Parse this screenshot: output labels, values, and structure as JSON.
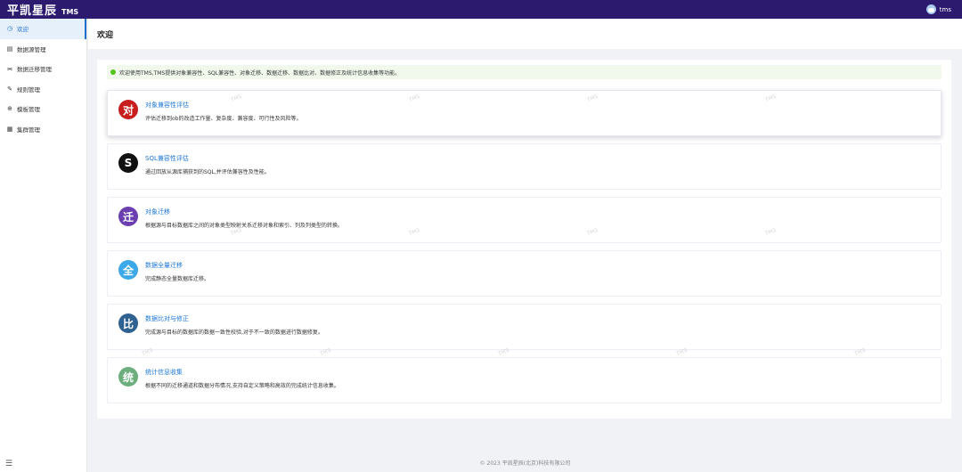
{
  "header": {
    "brand_cn": "平凯星辰",
    "brand_en": "TMS",
    "username": "tms"
  },
  "sidebar": {
    "items": [
      {
        "label": "欢迎",
        "icon": "clock-icon",
        "glyph": "◷"
      },
      {
        "label": "数据源管理",
        "icon": "document-icon",
        "glyph": "▤"
      },
      {
        "label": "数据迁移管理",
        "icon": "share-icon",
        "glyph": "⫘"
      },
      {
        "label": "规则管理",
        "icon": "edit-icon",
        "glyph": "✎"
      },
      {
        "label": "模板管理",
        "icon": "globe-icon",
        "glyph": "⊕"
      },
      {
        "label": "集群管理",
        "icon": "grid-icon",
        "glyph": "▦"
      }
    ],
    "collapse_glyph": "☰"
  },
  "page": {
    "title": "欢迎"
  },
  "notice": {
    "text": "欢迎使用TMS,TMS提供对象兼容性、SQL兼容性、对象迁移、数据迁移、数据比对、数据修正及统计信息收集等功能。"
  },
  "cards": [
    {
      "icon_text": "对",
      "color": "#c81e1e",
      "title": "对象兼容性评估",
      "desc": "评估迁移到ob的改造工作量、复杂度、兼容度、可行性及风险等。"
    },
    {
      "icon_text": "S",
      "color": "#111111",
      "title": "SQL兼容性评估",
      "desc": "通过回放从源库捕获到的SQL,并评估兼容性及性能。"
    },
    {
      "icon_text": "迁",
      "color": "#6b3fb0",
      "title": "对象迁移",
      "desc": "根据源与目标数据库之间的对象类型映射关系迁移对象和索引、列及列类型的转换。"
    },
    {
      "icon_text": "全",
      "color": "#3da9e8",
      "title": "数据全量迁移",
      "desc": "完成静态全量数据库迁移。"
    },
    {
      "icon_text": "比",
      "color": "#2f6191",
      "title": "数据比对与修正",
      "desc": "完成源与目标的数据库的数据一致性校验,对于不一致的数据进行数据修复。"
    },
    {
      "icon_text": "统",
      "color": "#6cae7d",
      "title": "统计信息收集",
      "desc": "根据不同的迁移通道和数据分布情况,支持自定义策略和高效的完成统计信息收集。"
    }
  ],
  "watermark": "TMS",
  "footer": {
    "text": "© 2023 平凯星辰(北京)科技有限公司"
  }
}
